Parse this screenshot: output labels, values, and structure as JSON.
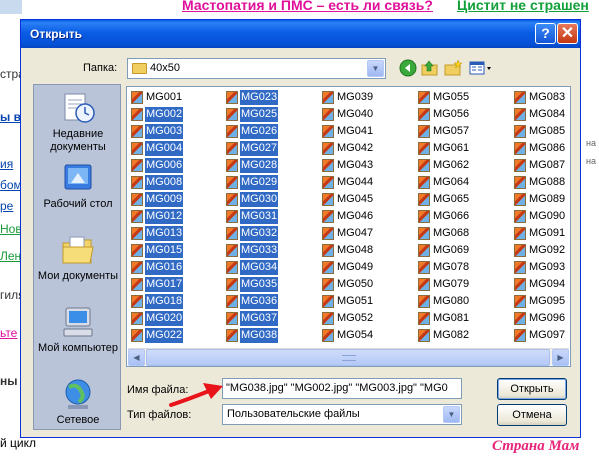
{
  "background": {
    "top_links": [
      "Мастопатия и ПМС – есть ли связь?",
      "Цистит не страшен"
    ],
    "left_fragments": [
      "стра",
      "ы в",
      "ия",
      "бом",
      "ре",
      "Нов",
      "Лен",
      "гиля",
      "ьте",
      "ны",
      "цикл"
    ],
    "right_fragments": [
      "на",
      "на"
    ],
    "bottom_text": "й цикл",
    "watermark": "Страна Мам"
  },
  "dialog": {
    "title": "Открыть",
    "help_label": "?",
    "close_label": "✕",
    "folder_label": "Папка:",
    "folder_value": "40x50",
    "toolbar_icons": [
      "back-icon",
      "up-folder-icon",
      "new-folder-icon",
      "view-menu-icon"
    ],
    "places": [
      {
        "label": "Недавние документы",
        "icon": "recent-documents-icon"
      },
      {
        "label": "Рабочий стол",
        "icon": "desktop-icon"
      },
      {
        "label": "Мои документы",
        "icon": "my-documents-icon"
      },
      {
        "label": "Мой компьютер",
        "icon": "my-computer-icon"
      },
      {
        "label": "Сетевое",
        "icon": "network-icon"
      }
    ],
    "file_columns": [
      [
        {
          "name": "MG001",
          "selected": false
        },
        {
          "name": "MG002",
          "selected": true
        },
        {
          "name": "MG003",
          "selected": true
        },
        {
          "name": "MG004",
          "selected": true
        },
        {
          "name": "MG006",
          "selected": true
        },
        {
          "name": "MG008",
          "selected": true
        },
        {
          "name": "MG009",
          "selected": true
        },
        {
          "name": "MG012",
          "selected": true
        },
        {
          "name": "MG013",
          "selected": true
        },
        {
          "name": "MG015",
          "selected": true
        },
        {
          "name": "MG016",
          "selected": true
        },
        {
          "name": "MG017",
          "selected": true
        },
        {
          "name": "MG018",
          "selected": true
        },
        {
          "name": "MG020",
          "selected": true
        },
        {
          "name": "MG022",
          "selected": true
        }
      ],
      [
        {
          "name": "MG023",
          "selected": true
        },
        {
          "name": "MG025",
          "selected": true
        },
        {
          "name": "MG026",
          "selected": true
        },
        {
          "name": "MG027",
          "selected": true
        },
        {
          "name": "MG028",
          "selected": true
        },
        {
          "name": "MG029",
          "selected": true
        },
        {
          "name": "MG030",
          "selected": true
        },
        {
          "name": "MG031",
          "selected": true
        },
        {
          "name": "MG032",
          "selected": true
        },
        {
          "name": "MG033",
          "selected": true
        },
        {
          "name": "MG034",
          "selected": true
        },
        {
          "name": "MG035",
          "selected": true
        },
        {
          "name": "MG036",
          "selected": true
        },
        {
          "name": "MG037",
          "selected": true
        },
        {
          "name": "MG038",
          "selected": true
        }
      ],
      [
        {
          "name": "MG039",
          "selected": false
        },
        {
          "name": "MG040",
          "selected": false
        },
        {
          "name": "MG041",
          "selected": false
        },
        {
          "name": "MG042",
          "selected": false
        },
        {
          "name": "MG043",
          "selected": false
        },
        {
          "name": "MG044",
          "selected": false
        },
        {
          "name": "MG045",
          "selected": false
        },
        {
          "name": "MG046",
          "selected": false
        },
        {
          "name": "MG047",
          "selected": false
        },
        {
          "name": "MG048",
          "selected": false
        },
        {
          "name": "MG049",
          "selected": false
        },
        {
          "name": "MG050",
          "selected": false
        },
        {
          "name": "MG051",
          "selected": false
        },
        {
          "name": "MG052",
          "selected": false
        },
        {
          "name": "MG054",
          "selected": false
        }
      ],
      [
        {
          "name": "MG055",
          "selected": false
        },
        {
          "name": "MG056",
          "selected": false
        },
        {
          "name": "MG057",
          "selected": false
        },
        {
          "name": "MG061",
          "selected": false
        },
        {
          "name": "MG062",
          "selected": false
        },
        {
          "name": "MG064",
          "selected": false
        },
        {
          "name": "MG065",
          "selected": false
        },
        {
          "name": "MG066",
          "selected": false
        },
        {
          "name": "MG068",
          "selected": false
        },
        {
          "name": "MG069",
          "selected": false
        },
        {
          "name": "MG078",
          "selected": false
        },
        {
          "name": "MG079",
          "selected": false
        },
        {
          "name": "MG080",
          "selected": false
        },
        {
          "name": "MG081",
          "selected": false
        },
        {
          "name": "MG082",
          "selected": false
        }
      ],
      [
        {
          "name": "MG083",
          "selected": false
        },
        {
          "name": "MG084",
          "selected": false
        },
        {
          "name": "MG085",
          "selected": false
        },
        {
          "name": "MG086",
          "selected": false
        },
        {
          "name": "MG087",
          "selected": false
        },
        {
          "name": "MG088",
          "selected": false
        },
        {
          "name": "MG089",
          "selected": false
        },
        {
          "name": "MG090",
          "selected": false
        },
        {
          "name": "MG091",
          "selected": false
        },
        {
          "name": "MG092",
          "selected": false
        },
        {
          "name": "MG093",
          "selected": false
        },
        {
          "name": "MG094",
          "selected": false
        },
        {
          "name": "MG095",
          "selected": false
        },
        {
          "name": "MG096",
          "selected": false
        },
        {
          "name": "MG097",
          "selected": false
        }
      ]
    ],
    "filename_label": "Имя файла:",
    "filename_value": "\"MG038.jpg\" \"MG002.jpg\" \"MG003.jpg\" \"MG0",
    "filetype_label": "Тип файлов:",
    "filetype_value": "Пользовательские файлы",
    "open_button": "Открыть",
    "cancel_button": "Отмена",
    "colors": {
      "titlebar": "#0a5de4",
      "selection": "#316ac5",
      "face": "#ece9d8",
      "places_bar": "#b9c4d9",
      "arrow": "#e8141a"
    }
  }
}
